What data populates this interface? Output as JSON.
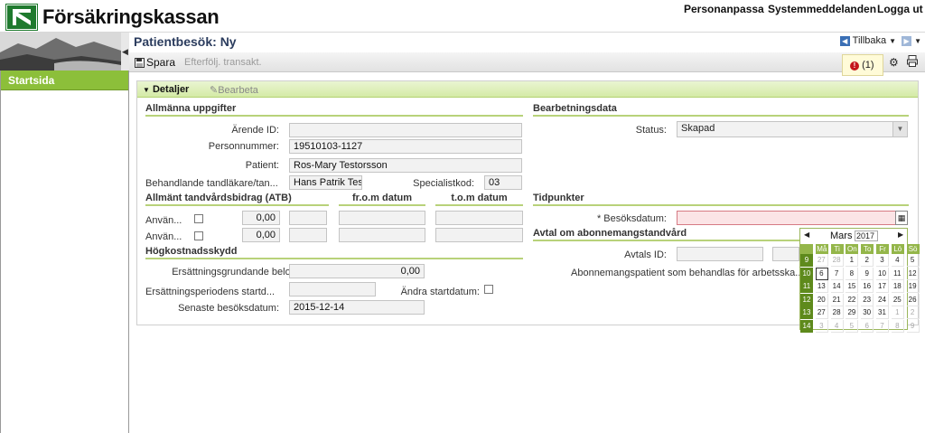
{
  "header": {
    "logo_text": "Försäkringskassan",
    "links": [
      "Personanpassa",
      "Systemmeddelanden",
      "Logga ut"
    ]
  },
  "sidebar": {
    "items": [
      {
        "label": "Startsida"
      }
    ]
  },
  "titlebar": {
    "title": "Patientbesök: Ny",
    "back_label": "Tillbaka"
  },
  "toolbar": {
    "save_label": "Spara",
    "followup_label": "Efterfölj. transakt.",
    "messages_count": "(1)"
  },
  "tabs": {
    "details": "Detaljer",
    "edit": "Bearbeta"
  },
  "general": {
    "title": "Allmänna uppgifter",
    "arende_label": "Ärende ID:",
    "arende_value": "",
    "personnummer_label": "Personnummer:",
    "personnummer_value": "19510103-1127",
    "patient_label": "Patient:",
    "patient_value": "Ros-Mary Testorsson",
    "tandlakare_label": "Behandlande tandläkare/tan...",
    "tandlakare_value": "Hans Patrik Testor",
    "specialist_label": "Specialistkod:",
    "specialist_value": "03"
  },
  "atb": {
    "title": "Allmänt tandvårdsbidrag (ATB)",
    "from_title": "fr.o.m datum",
    "to_title": "t.o.m datum",
    "rows": [
      {
        "label": "Använ...",
        "amount": "0,00"
      },
      {
        "label": "Använ...",
        "amount": "0,00"
      }
    ]
  },
  "hogkostnad": {
    "title": "Högkostnadsskydd",
    "belopp_label": "Ersättningsgrundande belopp:",
    "belopp_value": "0,00",
    "startd_label": "Ersättningsperiodens startd...",
    "startd_value": "",
    "andra_label": "Ändra startdatum:",
    "senaste_label": "Senaste besöksdatum:",
    "senaste_value": "2015-12-14"
  },
  "processing": {
    "title": "Bearbetningsdata",
    "status_label": "Status:",
    "status_value": "Skapad"
  },
  "timepoints": {
    "title": "Tidpunkter",
    "besok_label": "* Besöksdatum:"
  },
  "subscription": {
    "title": "Avtal om abonnemangstandvård",
    "avtal_label": "Avtals ID:",
    "abonnemang_label": "Abonnemangspatient som behandlas för arbetsska..."
  },
  "calendar": {
    "month": "Mars",
    "year": "2017",
    "weekdays": [
      "Må",
      "Ti",
      "On",
      "To",
      "Fr",
      "Lö",
      "Sö"
    ],
    "weeks": [
      "9",
      "10",
      "11",
      "12",
      "13",
      "14"
    ],
    "days": [
      [
        "27",
        "28",
        "1",
        "2",
        "3",
        "4",
        "5"
      ],
      [
        "6",
        "7",
        "8",
        "9",
        "10",
        "11",
        "12"
      ],
      [
        "13",
        "14",
        "15",
        "16",
        "17",
        "18",
        "19"
      ],
      [
        "20",
        "21",
        "22",
        "23",
        "24",
        "25",
        "26"
      ],
      [
        "27",
        "28",
        "29",
        "30",
        "31",
        "1",
        "2"
      ],
      [
        "3",
        "4",
        "5",
        "6",
        "7",
        "8",
        "9"
      ]
    ]
  },
  "colors": {
    "accent": "#8cbf3a",
    "title": "#2b3c5e"
  }
}
